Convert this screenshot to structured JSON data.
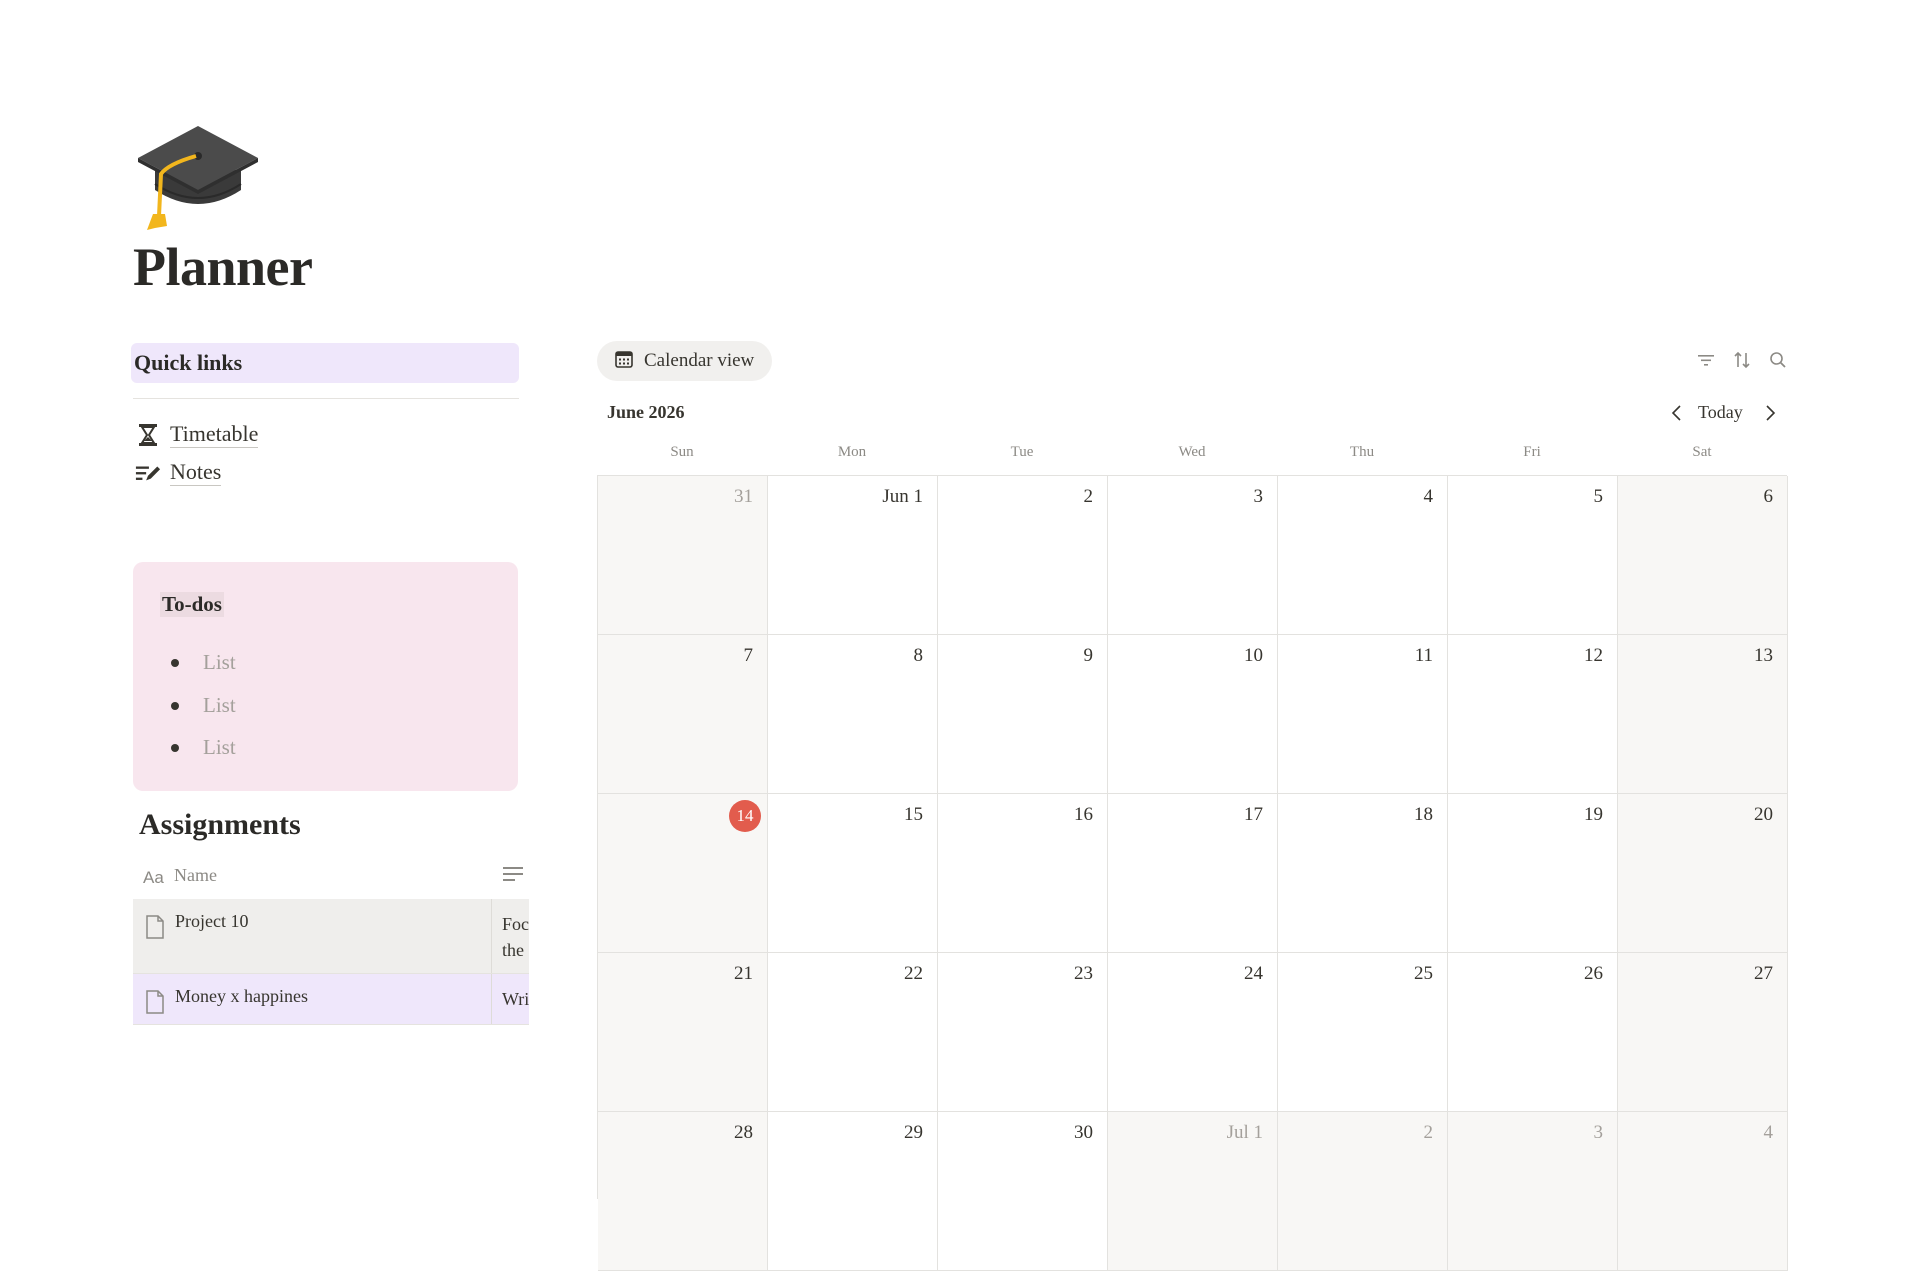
{
  "page": {
    "title": "Planner",
    "icon": "graduation-cap-icon"
  },
  "quick_links": {
    "title": "Quick links",
    "items": [
      {
        "label": "Timetable",
        "icon": "hourglass-icon"
      },
      {
        "label": "Notes",
        "icon": "edit-lines-icon"
      }
    ]
  },
  "todos": {
    "title": "To-dos",
    "items": [
      "List",
      "List",
      "List"
    ]
  },
  "assignments": {
    "title": "Assignments",
    "column_icon": "Aa",
    "column_name": "Name",
    "rows": [
      {
        "name": "Project 10",
        "snippet_line1": "Foc",
        "snippet_line2": "the"
      },
      {
        "name": "Money x happines",
        "snippet_line1": "Wri"
      }
    ]
  },
  "calendar": {
    "view_label": "Calendar view",
    "month": "June 2026",
    "today_label": "Today",
    "weekdays": [
      "Sun",
      "Mon",
      "Tue",
      "Wed",
      "Thu",
      "Fri",
      "Sat"
    ],
    "weeks": [
      [
        "31",
        "Jun 1",
        "2",
        "3",
        "4",
        "5",
        "6"
      ],
      [
        "7",
        "8",
        "9",
        "10",
        "11",
        "12",
        "13"
      ],
      [
        "14",
        "15",
        "16",
        "17",
        "18",
        "19",
        "20"
      ],
      [
        "21",
        "22",
        "23",
        "24",
        "25",
        "26",
        "27"
      ],
      [
        "28",
        "29",
        "30",
        "Jul 1",
        "2",
        "3",
        "4"
      ]
    ],
    "today": "14",
    "today_color": "#e25c4d"
  },
  "colors": {
    "quick_links_bg": "#efe7fb",
    "todos_bg": "#f8e6ee",
    "weekend_bg": "#f8f7f5"
  }
}
